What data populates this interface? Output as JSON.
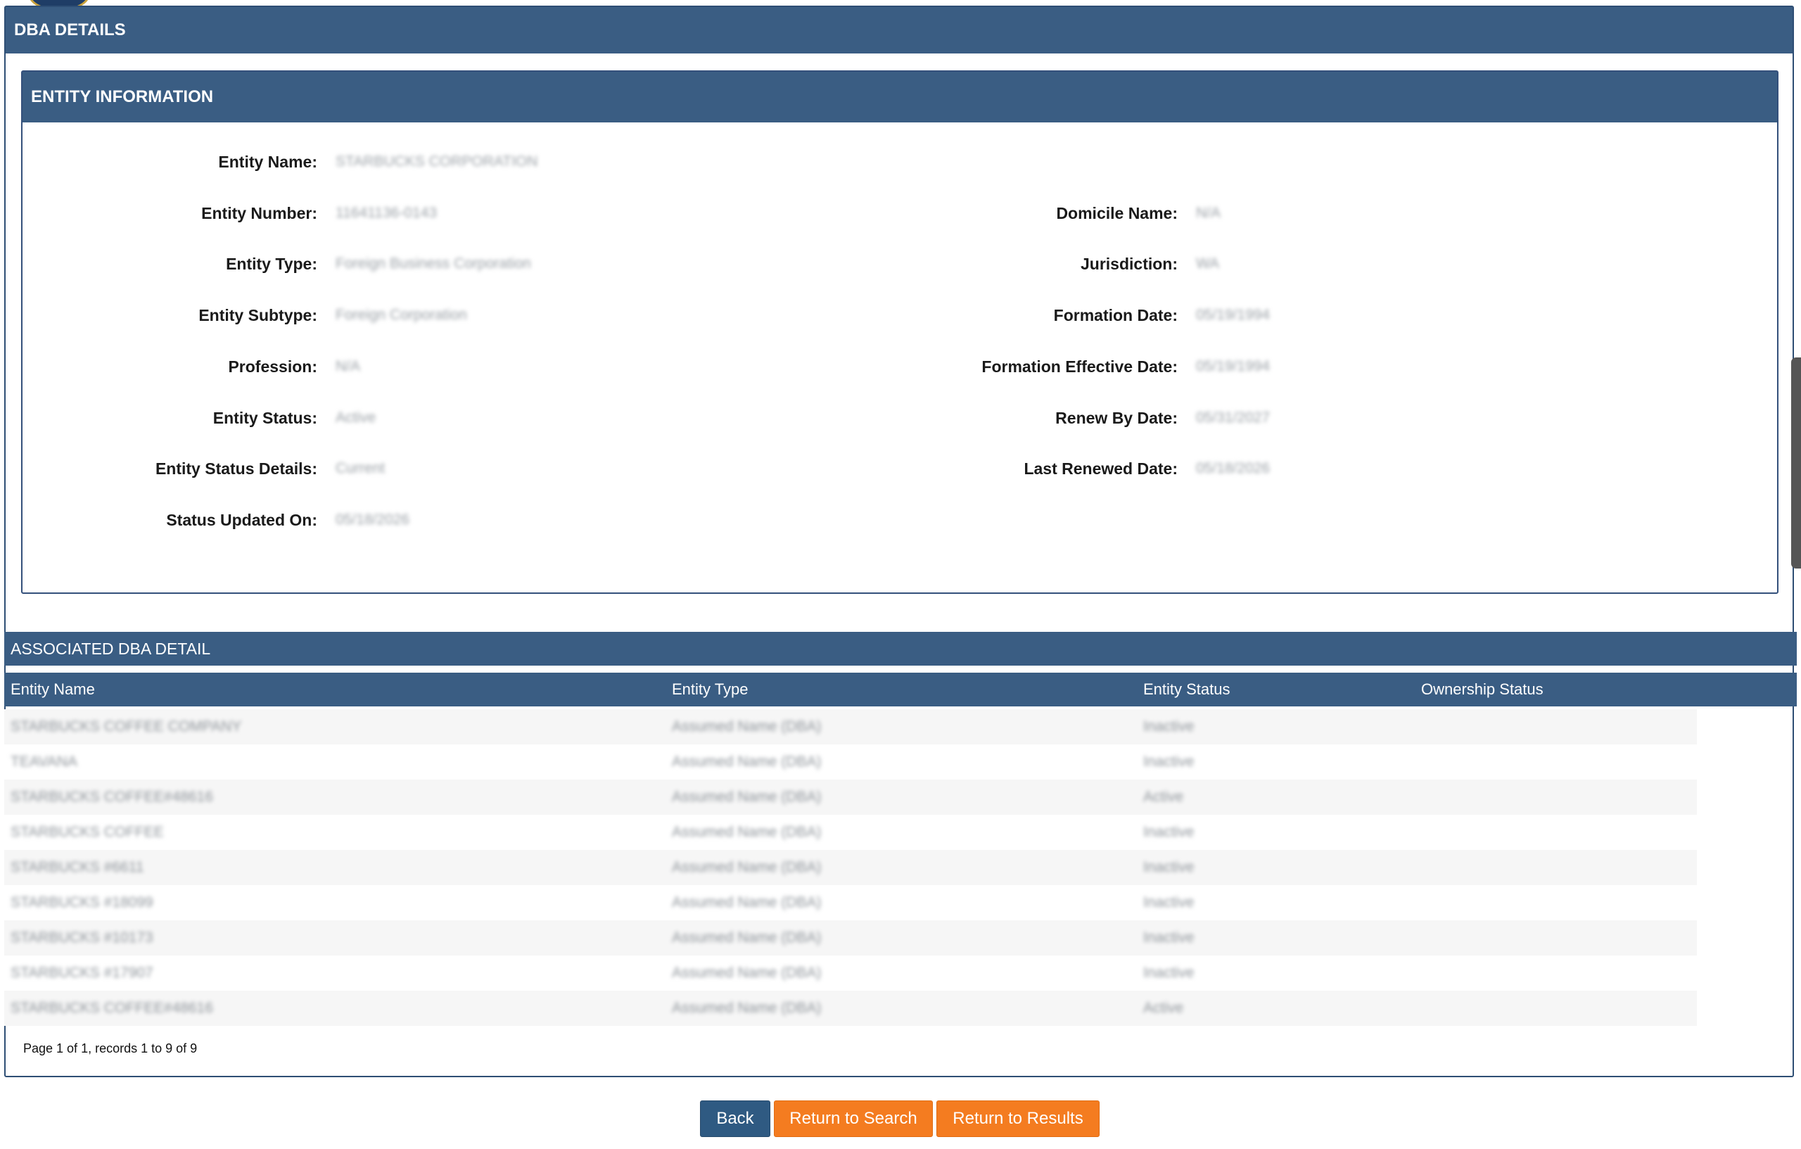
{
  "dba_details": {
    "title": "DBA DETAILS"
  },
  "entity_information": {
    "title": "ENTITY INFORMATION",
    "left": [
      {
        "label": "Entity Name:",
        "value": "STARBUCKS CORPORATION"
      },
      {
        "label": "Entity Number:",
        "value": "11641136-0143"
      },
      {
        "label": "Entity Type:",
        "value": "Foreign Business Corporation"
      },
      {
        "label": "Entity Subtype:",
        "value": "Foreign Corporation"
      },
      {
        "label": "Profession:",
        "value": "N/A"
      },
      {
        "label": "Entity Status:",
        "value": "Active"
      },
      {
        "label": "Entity Status Details:",
        "value": "Current"
      },
      {
        "label": "Status Updated On:",
        "value": "05/18/2026"
      }
    ],
    "right": [
      {
        "label": "Domicile Name:",
        "value": "N/A"
      },
      {
        "label": "Jurisdiction:",
        "value": "WA"
      },
      {
        "label": "Formation Date:",
        "value": "05/19/1994"
      },
      {
        "label": "Formation Effective Date:",
        "value": "05/19/1994"
      },
      {
        "label": "Renew By Date:",
        "value": "05/31/2027"
      },
      {
        "label": "Last Renewed Date:",
        "value": "05/18/2026"
      }
    ]
  },
  "associated_dba": {
    "title": "ASSOCIATED DBA DETAIL",
    "columns": [
      "Entity Name",
      "Entity Type",
      "Entity Status",
      "Ownership Status"
    ],
    "rows": [
      {
        "name": "STARBUCKS COFFEE COMPANY",
        "type": "Assumed Name (DBA)",
        "status": "Inactive",
        "ownership": ""
      },
      {
        "name": "TEAVANA",
        "type": "Assumed Name (DBA)",
        "status": "Inactive",
        "ownership": ""
      },
      {
        "name": "STARBUCKS COFFEE#48616",
        "type": "Assumed Name (DBA)",
        "status": "Active",
        "ownership": ""
      },
      {
        "name": "STARBUCKS COFFEE",
        "type": "Assumed Name (DBA)",
        "status": "Inactive",
        "ownership": ""
      },
      {
        "name": "STARBUCKS #6611",
        "type": "Assumed Name (DBA)",
        "status": "Inactive",
        "ownership": ""
      },
      {
        "name": "STARBUCKS #18099",
        "type": "Assumed Name (DBA)",
        "status": "Inactive",
        "ownership": ""
      },
      {
        "name": "STARBUCKS #10173",
        "type": "Assumed Name (DBA)",
        "status": "Inactive",
        "ownership": ""
      },
      {
        "name": "STARBUCKS #17907",
        "type": "Assumed Name (DBA)",
        "status": "Inactive",
        "ownership": ""
      },
      {
        "name": "STARBUCKS COFFEE#48616",
        "type": "Assumed Name (DBA)",
        "status": "Active",
        "ownership": ""
      }
    ],
    "pager": "Page 1 of 1, records 1 to 9 of 9"
  },
  "buttons": {
    "back": "Back",
    "return_search": "Return to Search",
    "return_results": "Return to Results"
  },
  "colors": {
    "header": "#3a5d83",
    "accent_orange": "#f47c20",
    "back_button": "#2f5a82"
  }
}
